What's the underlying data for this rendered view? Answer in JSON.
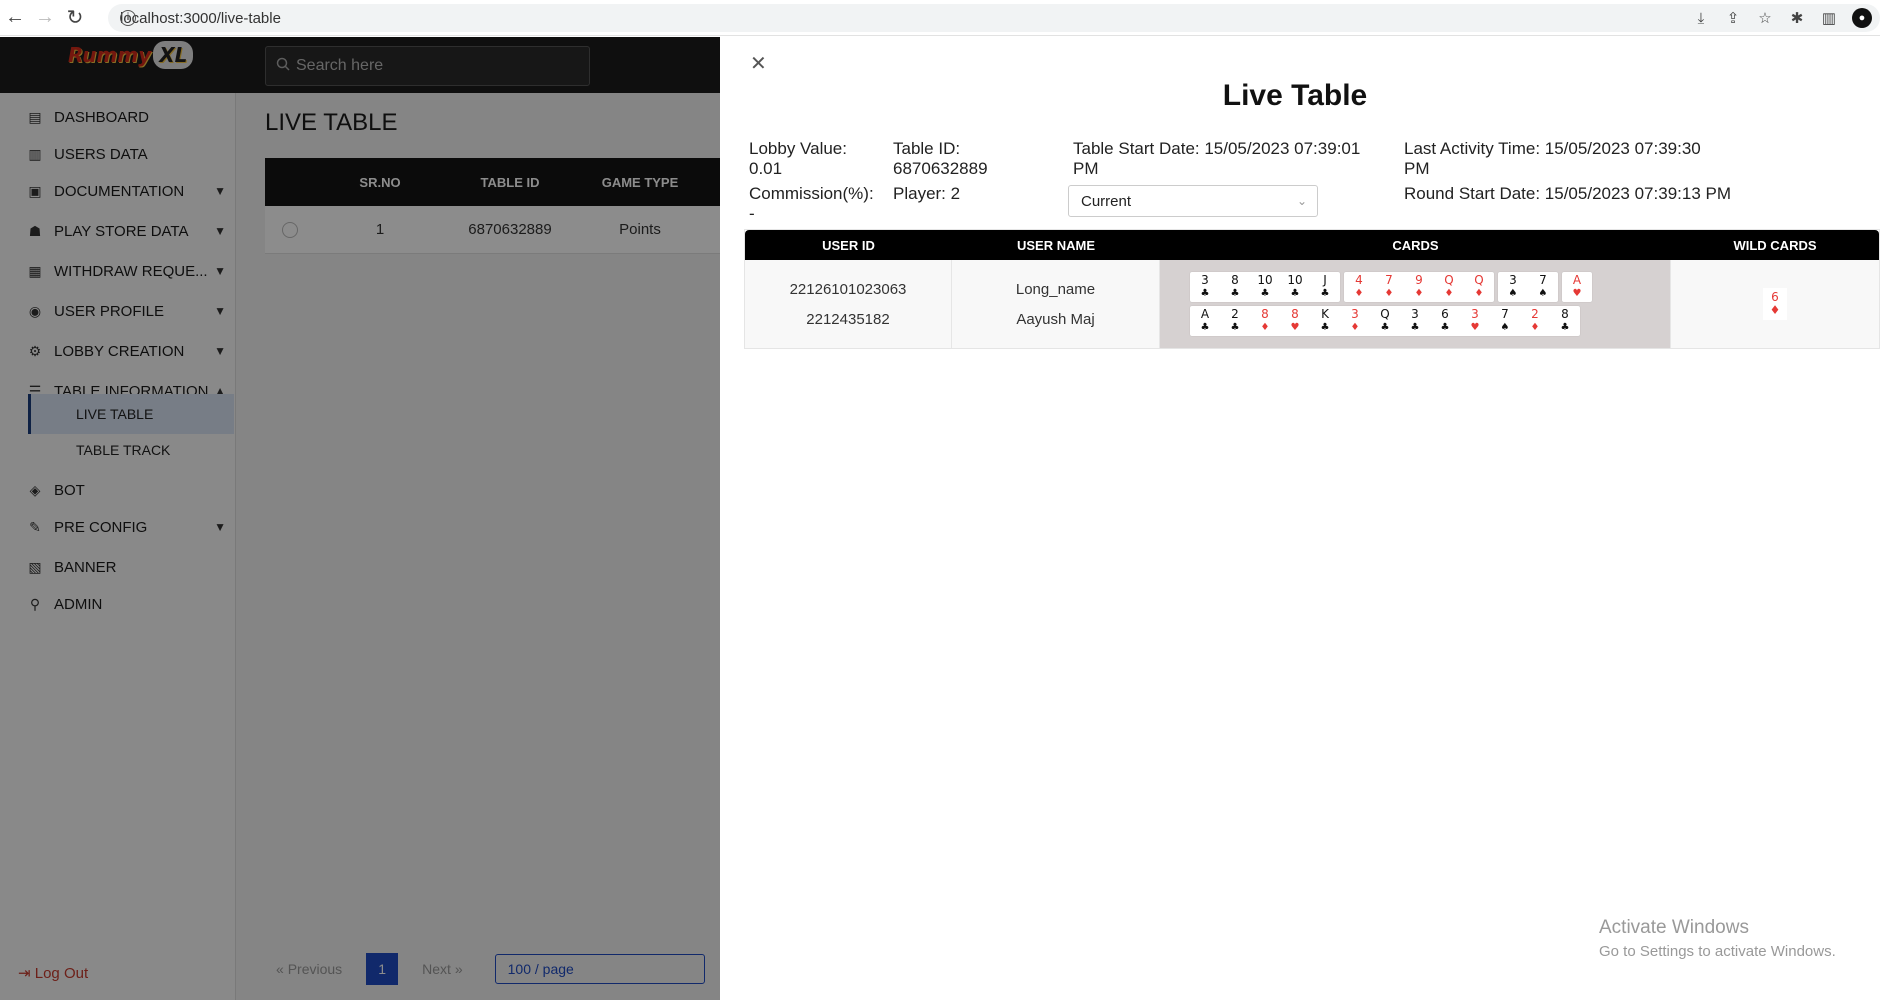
{
  "browser": {
    "url": "localhost:3000/live-table"
  },
  "app": {
    "logo": "Rummy",
    "logo_suffix": "XL",
    "search_placeholder": "Search here",
    "page_title": "LIVE TABLE",
    "logout": "Log Out"
  },
  "sidebar": {
    "items": [
      {
        "label": "DASHBOARD",
        "icon": "dashboard-icon"
      },
      {
        "label": "USERS DATA",
        "icon": "chart-icon"
      },
      {
        "label": "DOCUMENTATION",
        "icon": "document-icon"
      },
      {
        "label": "PLAY STORE DATA",
        "icon": "users-icon"
      },
      {
        "label": "WITHDRAW REQUE...",
        "icon": "clipboard-icon"
      },
      {
        "label": "USER PROFILE",
        "icon": "profile-icon"
      },
      {
        "label": "LOBBY CREATION",
        "icon": "lobby-icon"
      },
      {
        "label": "TABLE INFORMATION",
        "icon": "table-icon"
      },
      {
        "label": "BOT",
        "icon": "bot-icon"
      },
      {
        "label": "PRE CONFIG",
        "icon": "config-icon"
      },
      {
        "label": "BANNER",
        "icon": "banner-icon"
      },
      {
        "label": "ADMIN",
        "icon": "admin-icon"
      }
    ],
    "sub_items": [
      {
        "label": "LIVE TABLE"
      },
      {
        "label": "TABLE TRACK"
      }
    ]
  },
  "bg_table": {
    "headers": [
      "SR.NO",
      "TABLE ID",
      "GAME TYPE"
    ],
    "row": [
      "1",
      "6870632889",
      "Points"
    ]
  },
  "pagination": {
    "previous": "Previous",
    "page": "1",
    "next": "Next",
    "page_size": "100 / page"
  },
  "drawer": {
    "title": "Live Table",
    "lobby_value_label": "Lobby Value:",
    "lobby_value": "0.01",
    "commission_label": "Commission(%):",
    "commission_value": "-",
    "table_id_label": "Table ID:",
    "table_id": "6870632889",
    "player": "Player: 2",
    "table_start_line1": "Table Start Date: 15/05/2023 07:39:01",
    "table_start_line2": "PM",
    "last_activity_line1": "Last Activity Time: 15/05/2023 07:39:30",
    "last_activity_line2": "PM",
    "round_start": "Round Start Date: 15/05/2023 07:39:13 PM",
    "select_value": "Current",
    "headers": [
      "USER ID",
      "USER NAME",
      "CARDS",
      "WILD CARDS"
    ],
    "rows": [
      {
        "user_id": "22126101023063",
        "user_name": "Long_name"
      },
      {
        "user_id": "2212435182",
        "user_name": "Aayush Maj"
      }
    ],
    "hands": [
      [
        [
          {
            "r": "3",
            "s": "♣",
            "c": "black"
          },
          {
            "r": "8",
            "s": "♣",
            "c": "black"
          },
          {
            "r": "10",
            "s": "♣",
            "c": "black"
          },
          {
            "r": "10",
            "s": "♣",
            "c": "black"
          },
          {
            "r": "J",
            "s": "♣",
            "c": "black"
          }
        ],
        [
          {
            "r": "4",
            "s": "♦",
            "c": "red"
          },
          {
            "r": "7",
            "s": "♦",
            "c": "red"
          },
          {
            "r": "9",
            "s": "♦",
            "c": "red"
          },
          {
            "r": "Q",
            "s": "♦",
            "c": "red"
          },
          {
            "r": "Q",
            "s": "♦",
            "c": "red"
          }
        ],
        [
          {
            "r": "3",
            "s": "♠",
            "c": "black"
          },
          {
            "r": "7",
            "s": "♠",
            "c": "black"
          }
        ],
        [
          {
            "r": "A",
            "s": "♥",
            "c": "red"
          }
        ]
      ],
      [
        [
          {
            "r": "A",
            "s": "♣",
            "c": "black"
          },
          {
            "r": "2",
            "s": "♣",
            "c": "black"
          },
          {
            "r": "8",
            "s": "♦",
            "c": "red"
          },
          {
            "r": "8",
            "s": "♥",
            "c": "red"
          },
          {
            "r": "K",
            "s": "♣",
            "c": "black"
          },
          {
            "r": "3",
            "s": "♦",
            "c": "red"
          },
          {
            "r": "Q",
            "s": "♣",
            "c": "black"
          },
          {
            "r": "3",
            "s": "♣",
            "c": "black"
          },
          {
            "r": "6",
            "s": "♣",
            "c": "black"
          },
          {
            "r": "3",
            "s": "♥",
            "c": "red"
          },
          {
            "r": "7",
            "s": "♠",
            "c": "black"
          },
          {
            "r": "2",
            "s": "♦",
            "c": "red"
          },
          {
            "r": "8",
            "s": "♣",
            "c": "black"
          }
        ]
      ]
    ],
    "wild_card": {
      "r": "6",
      "s": "♦",
      "c": "red"
    }
  },
  "watermark": {
    "line1": "Activate Windows",
    "line2": "Go to Settings to activate Windows."
  }
}
